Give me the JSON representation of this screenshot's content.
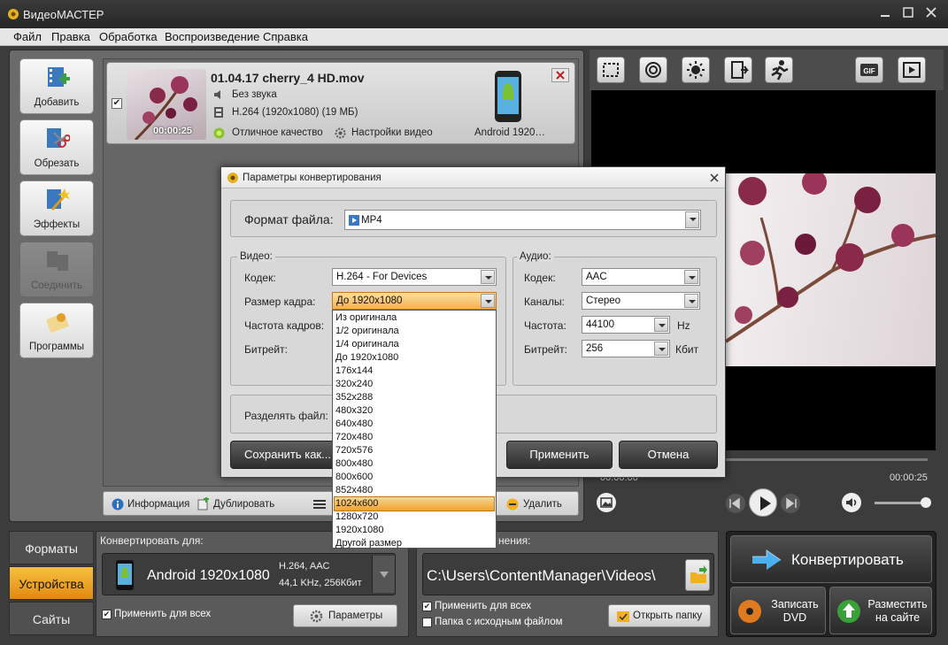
{
  "window": {
    "title": "ВидеоМАСТЕР"
  },
  "menu": [
    "Файл",
    "Правка",
    "Обработка",
    "Воспроизведение",
    "Справка"
  ],
  "sidebar": [
    {
      "label": "Добавить",
      "icon": "film-add-icon",
      "enabled": true
    },
    {
      "label": "Обрезать",
      "icon": "scissors-icon",
      "enabled": true
    },
    {
      "label": "Эффекты",
      "icon": "magic-wand-icon",
      "enabled": true
    },
    {
      "label": "Соединить",
      "icon": "join-icon",
      "enabled": false
    },
    {
      "label": "Программы",
      "icon": "programs-icon",
      "enabled": true
    }
  ],
  "file": {
    "name": "01.04.17 cherry_4 HD.mov",
    "audio": "Без звука",
    "video": "H.264 (1920x1080) (19 МБ)",
    "duration": "00:00:25",
    "quality": "Отличное качество",
    "settings": "Настройки видео",
    "device": "Android 1920…",
    "checked": true
  },
  "actions": {
    "info": "Информация",
    "duplicate": "Дублировать",
    "delete": "Удалить"
  },
  "player": {
    "time": "00:00:25",
    "time_start": "00:00:00"
  },
  "tabs": [
    "Форматы",
    "Устройства",
    "Сайты"
  ],
  "active_tab": "Устройства",
  "convert_for": {
    "label": "Конвертировать для:",
    "device": "Android 1920x1080",
    "codec": "H.264, AAC",
    "audio": "44,1 KHz, 256Кбит",
    "apply_all": "Применить для всех",
    "params": "Параметры"
  },
  "save_to": {
    "label_suffix": "нения:",
    "path": "C:\\Users\\ContentManager\\Videos\\",
    "apply_all": "Применить для всех",
    "source_folder": "Папка с исходным файлом",
    "open_folder": "Открыть папку"
  },
  "convert": {
    "main": "Конвертировать",
    "dvd": "Записать DVD",
    "publish": "Разместить на сайте"
  },
  "dialog": {
    "title": "Параметры конвертирования",
    "format_label": "Формат файла:",
    "format_value": "MP4",
    "video_group": "Видео:",
    "audio_group": "Аудио:",
    "v_codec_label": "Кодек:",
    "v_codec": "H.264 - For Devices",
    "frame_label": "Размер кадра:",
    "frame_value": "До 1920x1080",
    "fps_label": "Частота кадров:",
    "bitrate_label": "Битрейт:",
    "a_codec_label": "Кодек:",
    "a_codec": "AAC",
    "channels_label": "Каналы:",
    "channels": "Стерео",
    "freq_label": "Частота:",
    "freq": "44100",
    "freq_unit": "Hz",
    "a_bitrate_label": "Битрейт:",
    "a_bitrate": "256",
    "a_bitrate_unit": "Кбит",
    "split_label": "Разделять файл:",
    "save_as": "Сохранить как...",
    "apply": "Применить",
    "cancel": "Отмена"
  },
  "dropdown": {
    "items": [
      "Из оригинала",
      "1/2 оригинала",
      "1/4 оригинала",
      "До 1920x1080",
      "176x144",
      "320x240",
      "352x288",
      "480x320",
      "640x480",
      "720x480",
      "720x576",
      "800x480",
      "800x600",
      "852x480",
      "1024x600",
      "1280x720",
      "1920x1080",
      "Другой размер"
    ],
    "selected": "1024x600"
  }
}
